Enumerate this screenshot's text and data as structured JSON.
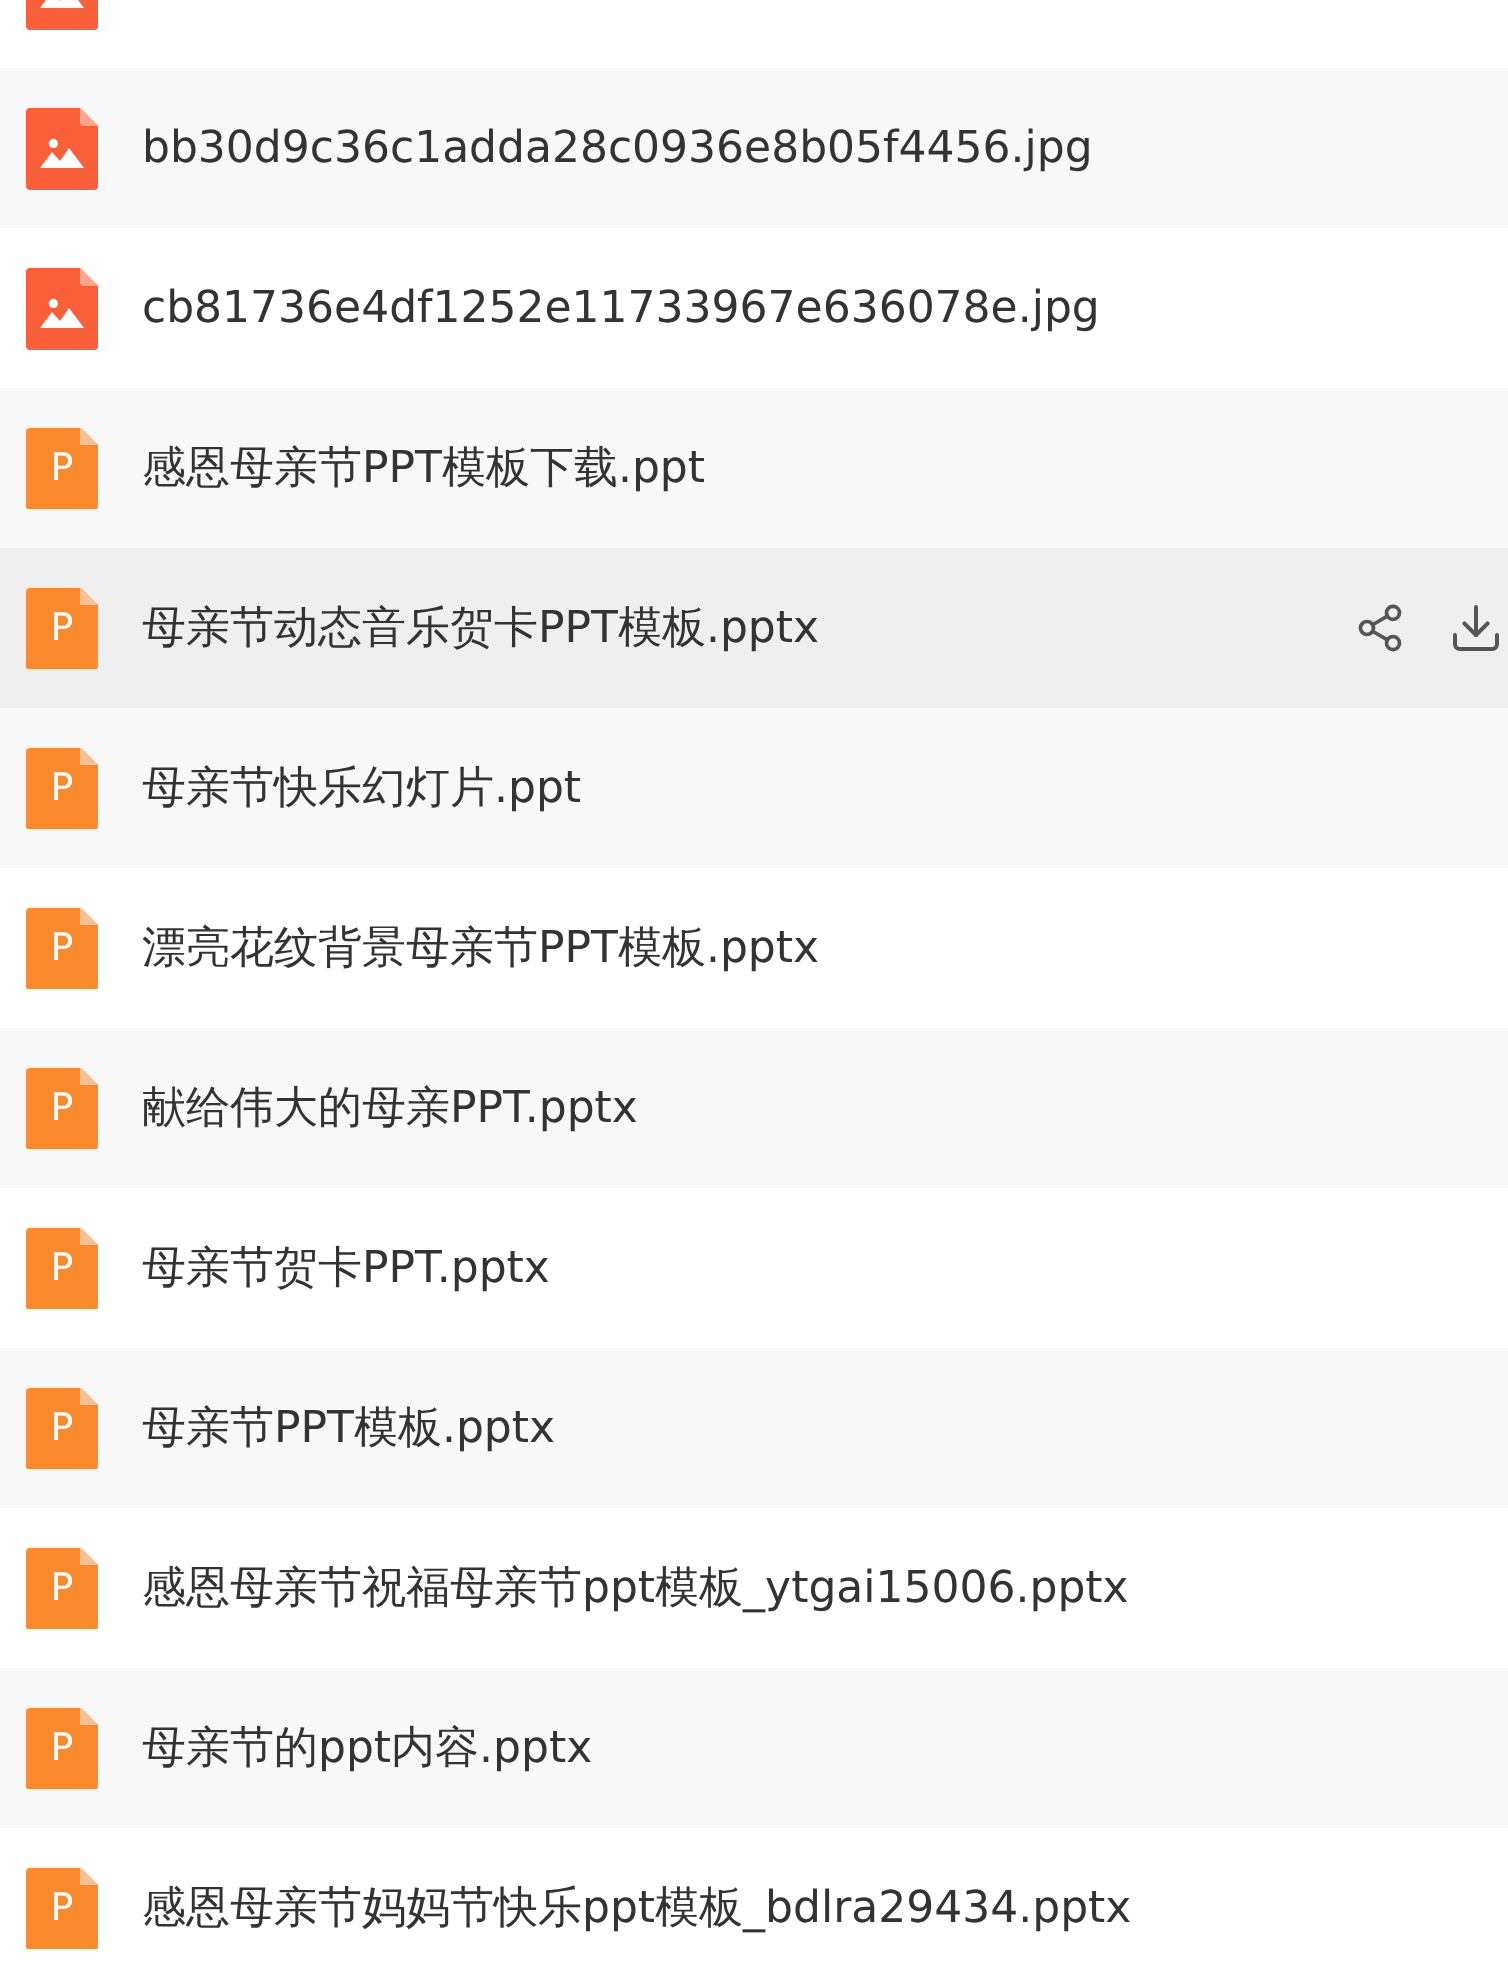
{
  "file_list": {
    "rows": [
      {
        "kind": "image",
        "highlighted": false
      },
      {
        "kind": "image",
        "name": "bb30d9c36c1adda28c0936e8b05f4456.jpg",
        "highlighted": false
      },
      {
        "kind": "image",
        "name": "cb81736e4df1252e11733967e636078e.jpg",
        "highlighted": false
      },
      {
        "kind": "ppt",
        "icon_letter": "P",
        "name": "感恩母亲节PPT模板下载.ppt",
        "highlighted": false
      },
      {
        "kind": "ppt",
        "icon_letter": "P",
        "name": "母亲节动态音乐贺卡PPT模板.pptx",
        "highlighted": true
      },
      {
        "kind": "ppt",
        "icon_letter": "P",
        "name": "母亲节快乐幻灯片.ppt",
        "highlighted": false
      },
      {
        "kind": "ppt",
        "icon_letter": "P",
        "name": "漂亮花纹背景母亲节PPT模板.pptx",
        "highlighted": false
      },
      {
        "kind": "ppt",
        "icon_letter": "P",
        "name": "献给伟大的母亲PPT.pptx",
        "highlighted": false
      },
      {
        "kind": "ppt",
        "icon_letter": "P",
        "name": "母亲节贺卡PPT.pptx",
        "highlighted": false
      },
      {
        "kind": "ppt",
        "icon_letter": "P",
        "name": "母亲节PPT模板.pptx",
        "highlighted": false
      },
      {
        "kind": "ppt",
        "icon_letter": "P",
        "name": "感恩母亲节祝福母亲节ppt模板_ytgai15006.pptx",
        "highlighted": false
      },
      {
        "kind": "ppt",
        "icon_letter": "P",
        "name": "母亲节的ppt内容.pptx",
        "highlighted": false
      },
      {
        "kind": "ppt",
        "icon_letter": "P",
        "name": "感恩母亲节妈妈节快乐ppt模板_bdlra29434.pptx",
        "highlighted": false
      }
    ]
  }
}
